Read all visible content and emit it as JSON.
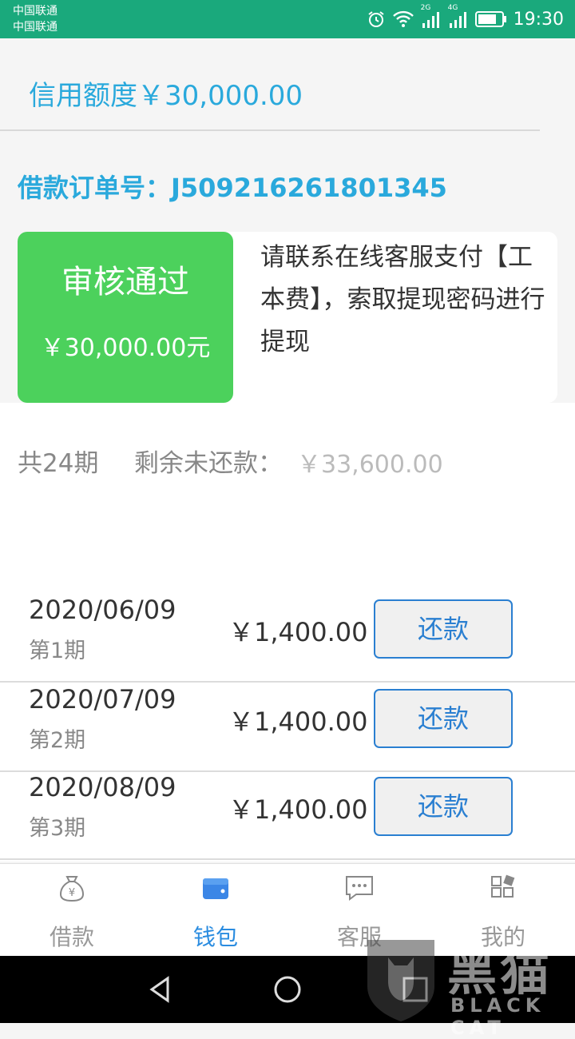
{
  "status_bar": {
    "carrier_1": "中国联通",
    "carrier_2": "中国联通",
    "network_1": "2G",
    "network_2": "4G",
    "time": "19:30",
    "icons": [
      "alarm-icon",
      "wifi-icon",
      "signal-icon",
      "battery-icon"
    ]
  },
  "credit": {
    "text": "信用额度￥30,000.00"
  },
  "order": {
    "text": "借款订单号：J509216261801345"
  },
  "approval": {
    "status": "审核通过",
    "amount": "￥30,000.00元",
    "notice": "请联系在线客服支付【工本费】，索取提现密码进行提现",
    "color": "#4cd15c"
  },
  "summary": {
    "periods": "共24期",
    "remaining_label": "剩余未还款：",
    "remaining_value": "￥33,600.00"
  },
  "installments": [
    {
      "date": "2020/06/09",
      "term": "第1期",
      "amount": "￥1,400.00",
      "button": "还款"
    },
    {
      "date": "2020/07/09",
      "term": "第2期",
      "amount": "￥1,400.00",
      "button": "还款"
    },
    {
      "date": "2020/08/09",
      "term": "第3期",
      "amount": "￥1,400.00",
      "button": "还款"
    }
  ],
  "tabs": [
    {
      "label": "借款",
      "icon": "money-bag-icon",
      "active": false
    },
    {
      "label": "钱包",
      "icon": "wallet-icon",
      "active": true
    },
    {
      "label": "客服",
      "icon": "chat-icon",
      "active": false
    },
    {
      "label": "我的",
      "icon": "apps-icon",
      "active": false
    }
  ],
  "watermark": {
    "text": "黑猫",
    "sub": "BLACK CAT"
  },
  "colors": {
    "status_bar": "#1aa97c",
    "accent_blue": "#2aa9dc",
    "button_blue": "#2a7fd1",
    "tab_active": "#2a8ce0"
  }
}
